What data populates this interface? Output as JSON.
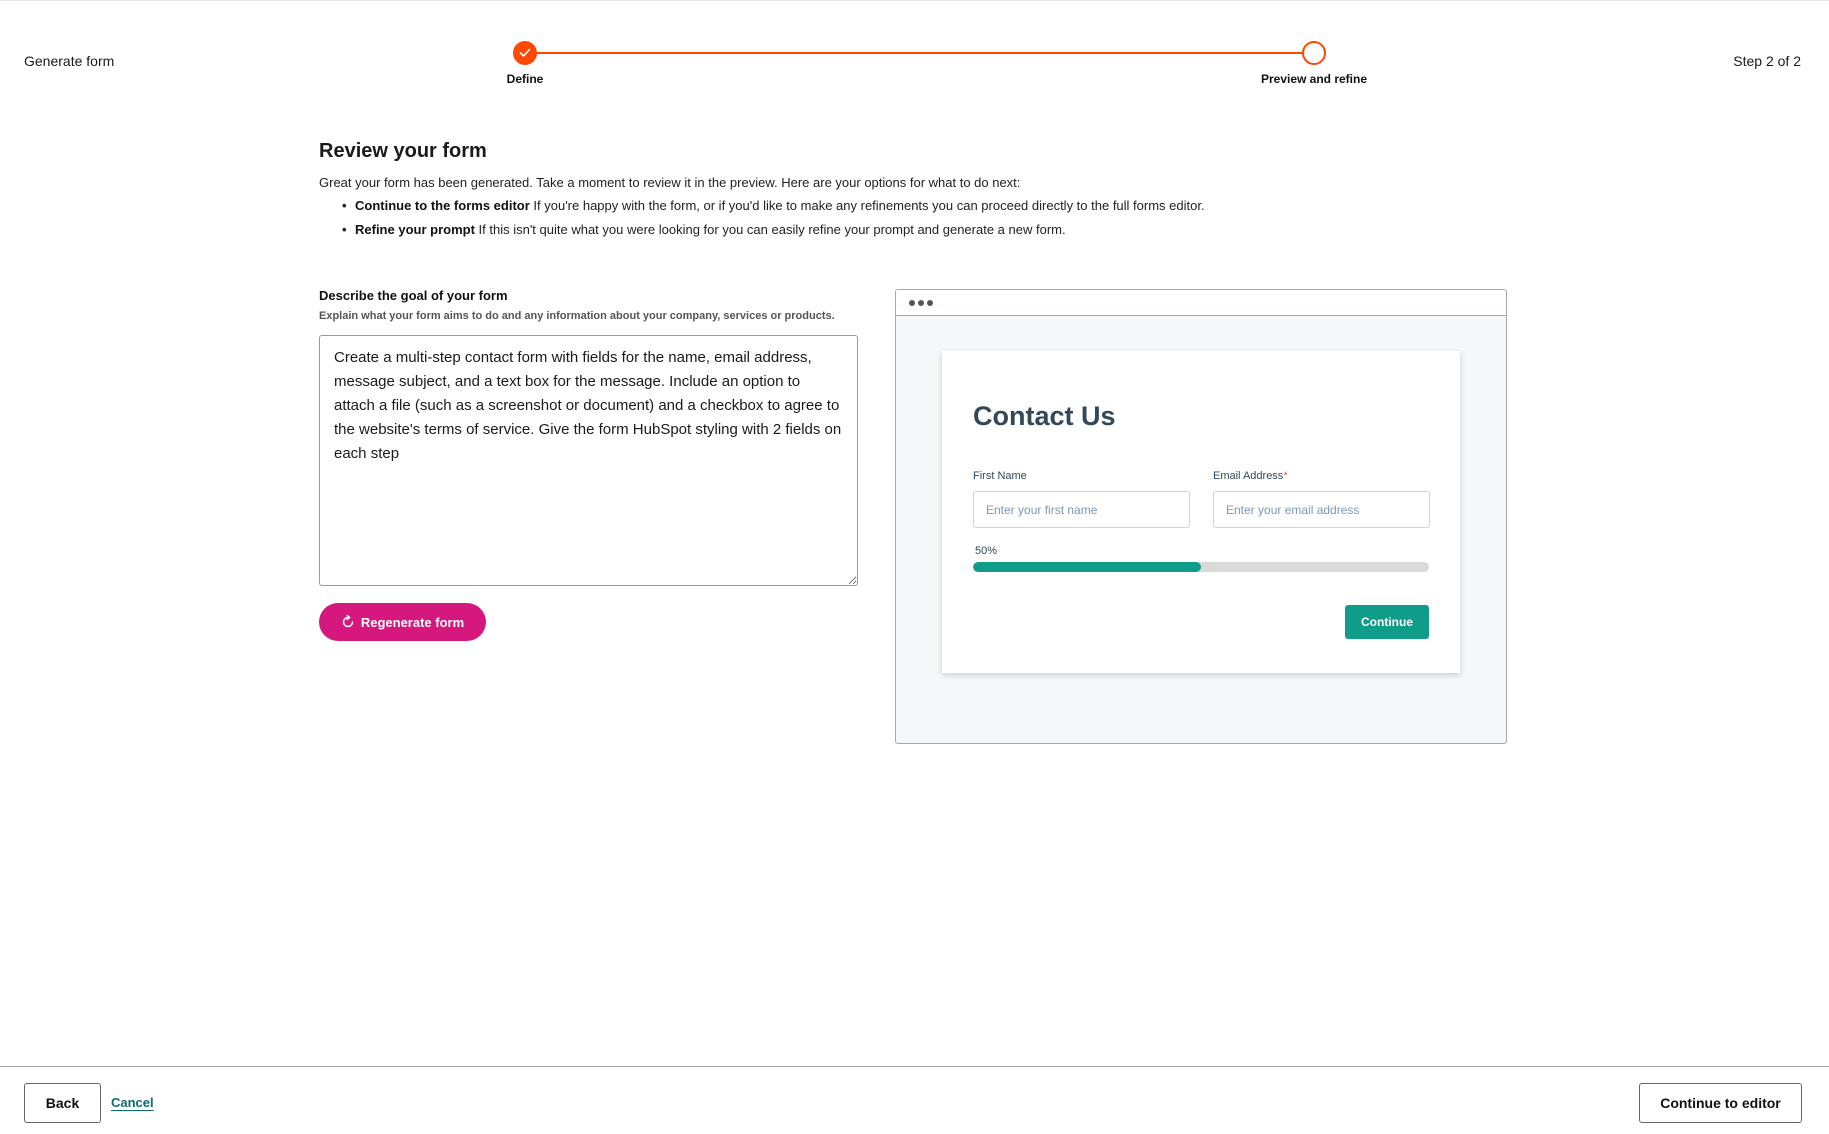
{
  "header": {
    "title": "Generate form",
    "step_indicator": "Step 2 of 2"
  },
  "stepper": {
    "steps": [
      {
        "label": "Define",
        "status": "complete"
      },
      {
        "label": "Preview and refine",
        "status": "current"
      }
    ]
  },
  "review": {
    "title": "Review your form",
    "intro": "Great your form has been generated. Take a moment to review it in the preview. Here are your options for what to do next:",
    "options": [
      {
        "title": "Continue to the forms editor",
        "text": " If you're happy with the form, or if you'd like to make any refinements you can proceed directly to the full forms editor."
      },
      {
        "title": "Refine your prompt",
        "text": " If this isn't quite what you were looking for you can easily refine your prompt and generate a new form."
      }
    ]
  },
  "goal": {
    "label": "Describe the goal of your form",
    "help": "Explain what your form aims to do and any information about your company, services or products.",
    "value": "Create a multi-step contact form with fields for the name, email address, message subject, and a text box for the message. Include an option to attach a file (such as a screenshot or document) and a checkbox to agree to the website's terms of service. Give the form HubSpot styling with 2 fields on each step"
  },
  "regenerate_label": "Regenerate form",
  "preview": {
    "form_title": "Contact Us",
    "fields": [
      {
        "label": "First Name",
        "required": false,
        "placeholder": "Enter your first name"
      },
      {
        "label": "Email Address",
        "required": true,
        "placeholder": "Enter your email address"
      }
    ],
    "required_mark": "*",
    "progress": {
      "label": "50%",
      "percent": 50
    },
    "continue_label": "Continue"
  },
  "footer": {
    "back_label": "Back",
    "cancel_label": "Cancel",
    "continue_editor_label": "Continue to editor"
  },
  "colors": {
    "accent": "#ff4800",
    "regenerate": "#d6177e",
    "teal": "#0f9d8a",
    "link": "#0c6d6f",
    "form_text": "#33475b"
  }
}
